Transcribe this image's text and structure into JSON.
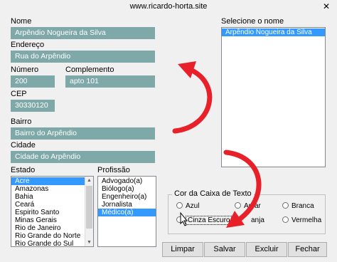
{
  "window": {
    "title": "www.ricardo-horta.site",
    "close_glyph": "✕"
  },
  "form": {
    "nome_label": "Nome",
    "nome_value": "Arpêndio Nogueira da Silva",
    "endereco_label": "Endereço",
    "endereco_value": "Rua do Arpêndio",
    "numero_label": "Número",
    "numero_value": "200",
    "complemento_label": "Complemento",
    "complemento_value": "apto 101",
    "cep_label": "CEP",
    "cep_value": "30330120",
    "bairro_label": "Bairro",
    "bairro_value": "Bairro do Arpêndio",
    "cidade_label": "Cidade",
    "cidade_value": "Cidade do Arpêndio",
    "estado_label": "Estado",
    "estados": [
      "Acre",
      "Amazonas",
      "Bahia",
      "Ceará",
      "Espirito Santo",
      "Minas Gerais",
      "Rio de Janeiro",
      "Rio Grande do Norte",
      "Rio Grande do Sul"
    ],
    "estado_selected": "Acre",
    "profissao_label": "Profissão",
    "profissoes": [
      "Advogado(a)",
      "Biólogo(a)",
      "Engenheiro(a)",
      "Jornalista",
      "Médico(a)"
    ],
    "profissao_selected": "Médico(a)"
  },
  "names_list": {
    "label": "Selecione o nome",
    "items": [
      "Arpêndio Nogueira da Silva"
    ],
    "selected": "Arpêndio Nogueira da Silva"
  },
  "color_frame": {
    "legend": "Cor da Caixa de Texto",
    "options": [
      "Azul",
      "Amarelo",
      "Branca",
      "Cinza Escuro",
      "Laranja",
      "Vermelha"
    ],
    "option_azul": "Azul",
    "option_amarelo_visible": "Amar",
    "option_branca": "Branca",
    "option_cinza": "Cinza Escuro",
    "option_laranja_visible": "anja",
    "option_vermelha": "Vermelha",
    "selected": "Cinza Escuro"
  },
  "buttons": {
    "limpar": "Limpar",
    "salvar": "Salvar",
    "excluir": "Excluir",
    "fechar": "Fechar"
  },
  "colors": {
    "textbox_fill": "#7fa8a8",
    "selection": "#3399ff",
    "annotation_arrow": "#e8202a"
  },
  "icons": {
    "close": "close-icon",
    "cursor": "mouse-cursor-icon",
    "annotation": "red-curved-arrow-icon"
  }
}
